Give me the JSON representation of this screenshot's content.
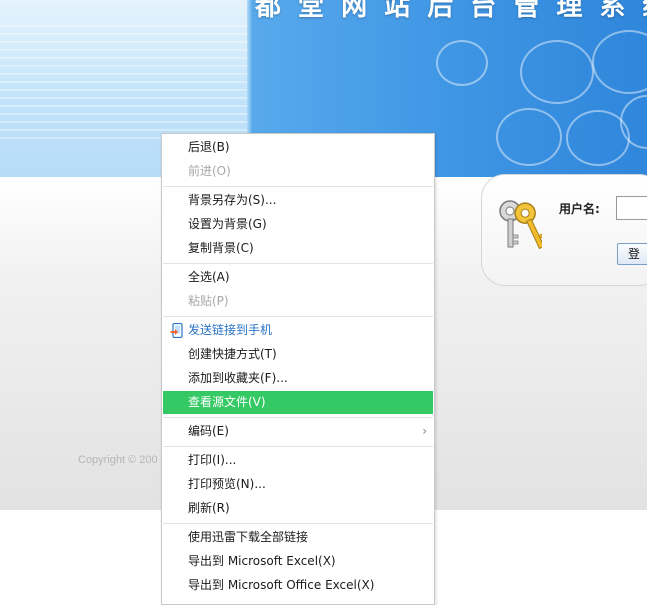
{
  "banner": {
    "title": "都 堂 网 站 后 台 管 理 系 统"
  },
  "login": {
    "username_label": "用户名:",
    "username_value": "",
    "login_button": "登"
  },
  "footer": {
    "copyright": "Copyright © 200"
  },
  "context_menu": {
    "items": [
      {
        "label": "后退(B)"
      },
      {
        "label": "前进(O)"
      },
      {
        "label": "背景另存为(S)..."
      },
      {
        "label": "设置为背景(G)"
      },
      {
        "label": "复制背景(C)"
      },
      {
        "label": "全选(A)"
      },
      {
        "label": "粘贴(P)"
      },
      {
        "label": "发送链接到手机"
      },
      {
        "label": "创建快捷方式(T)"
      },
      {
        "label": "添加到收藏夹(F)..."
      },
      {
        "label": "查看源文件(V)"
      },
      {
        "label": "编码(E)"
      },
      {
        "label": "打印(I)..."
      },
      {
        "label": "打印预览(N)..."
      },
      {
        "label": "刷新(R)"
      },
      {
        "label": "使用迅雷下载全部链接"
      },
      {
        "label": "导出到 Microsoft Excel(X)"
      },
      {
        "label": "导出到 Microsoft Office Excel(X)"
      }
    ],
    "colors": {
      "highlight": "#35c965",
      "link": "#2a73c6",
      "disabled": "#a8a8a8"
    }
  },
  "icons": {
    "key": "keys-icon",
    "phone": "phone-send-icon",
    "submenu": "chevron-right-icon"
  }
}
